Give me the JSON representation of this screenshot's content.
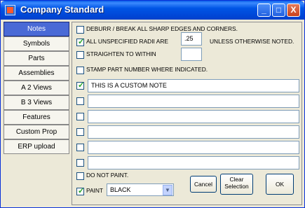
{
  "window": {
    "title": "Company Standard"
  },
  "titlebar_buttons": {
    "minimize": "_",
    "maximize": "□",
    "close": "X"
  },
  "sidebar": {
    "items": [
      {
        "label": "Notes",
        "active": true
      },
      {
        "label": "Symbols"
      },
      {
        "label": "Parts"
      },
      {
        "label": "Assemblies"
      },
      {
        "label": "A 2 Views"
      },
      {
        "label": "B 3 Views"
      },
      {
        "label": "Features"
      },
      {
        "label": "Custom Prop"
      },
      {
        "label": "ERP upload"
      }
    ]
  },
  "notes": {
    "deburr": {
      "label": "DEBURR / BREAK ALL SHARP EDGES AND CORNERS.",
      "checked": false
    },
    "radii": {
      "label": "ALL UNSPECIFIED RADII ARE",
      "checked": true,
      "value": ".25",
      "suffix": "UNLESS OTHERWISE NOTED."
    },
    "straighten": {
      "label": "STRAIGHTEN TO WITHIN",
      "checked": false,
      "value": ""
    },
    "stamp": {
      "label": "STAMP PART NUMBER WHERE INDICATED.",
      "checked": false
    },
    "custom": [
      {
        "checked": true,
        "value": "THIS IS A CUSTOM NOTE"
      },
      {
        "checked": false,
        "value": ""
      },
      {
        "checked": false,
        "value": ""
      },
      {
        "checked": false,
        "value": ""
      },
      {
        "checked": false,
        "value": ""
      },
      {
        "checked": false,
        "value": ""
      }
    ],
    "do_not_paint": {
      "label": "DO NOT PAINT.",
      "checked": false
    },
    "paint": {
      "label": "PAINT",
      "checked": true,
      "value": "BLACK"
    }
  },
  "buttons": {
    "cancel": "Cancel",
    "clear_line1": "Clear",
    "clear_line2": "Selection",
    "ok": "OK"
  },
  "check_glyph": "✓",
  "dropdown_glyph": "▼",
  "colors": {
    "title_bar": "#0055e5",
    "active_tab": "#4a6ad6",
    "check": "#21a121"
  }
}
